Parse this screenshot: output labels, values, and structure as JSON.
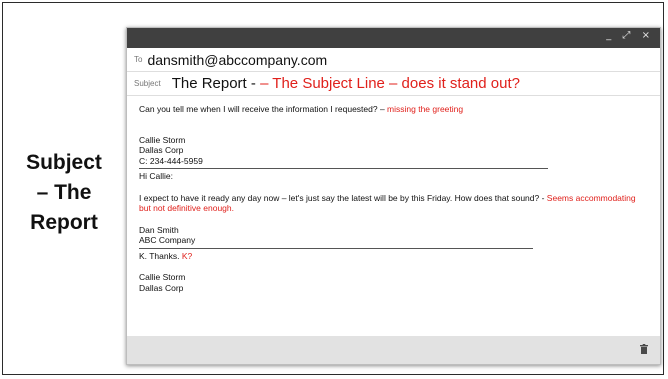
{
  "side_title": {
    "line1": "Subject",
    "line2": "– The",
    "line3": "Report"
  },
  "window": {
    "controls": {
      "minimize": "_",
      "expand": "⤢",
      "close": "×"
    }
  },
  "to": {
    "label": "To",
    "value": "dansmith@abccompany.com"
  },
  "subject": {
    "label": "Subject",
    "value": "The Report - ",
    "annotation": "– The Subject Line – does it  stand out?"
  },
  "message": {
    "line1_text": "Can you tell me when I will receive the information I requested? – ",
    "line1_note": "missing the greeting",
    "sig1": [
      "Callie Storm",
      "Dallas Corp",
      "C: 234-444-5959"
    ],
    "reply_greeting": "Hi Callie:",
    "reply_text": "I expect to have it ready any day now – let's just say the latest will be by this Friday.  How does that sound? - ",
    "reply_note": "Seems accommodating but not definitive enough.",
    "sig2": [
      "Dan Smith",
      "ABC Company"
    ],
    "final_text": "K. Thanks. ",
    "final_note": "K?",
    "sig3": [
      "Callie Storm",
      "Dallas Corp"
    ]
  },
  "icons": {
    "trash": "trash-icon"
  },
  "colors": {
    "annotation": "#e0201b",
    "titlebar": "#404040",
    "footer": "#e2e2e2"
  }
}
